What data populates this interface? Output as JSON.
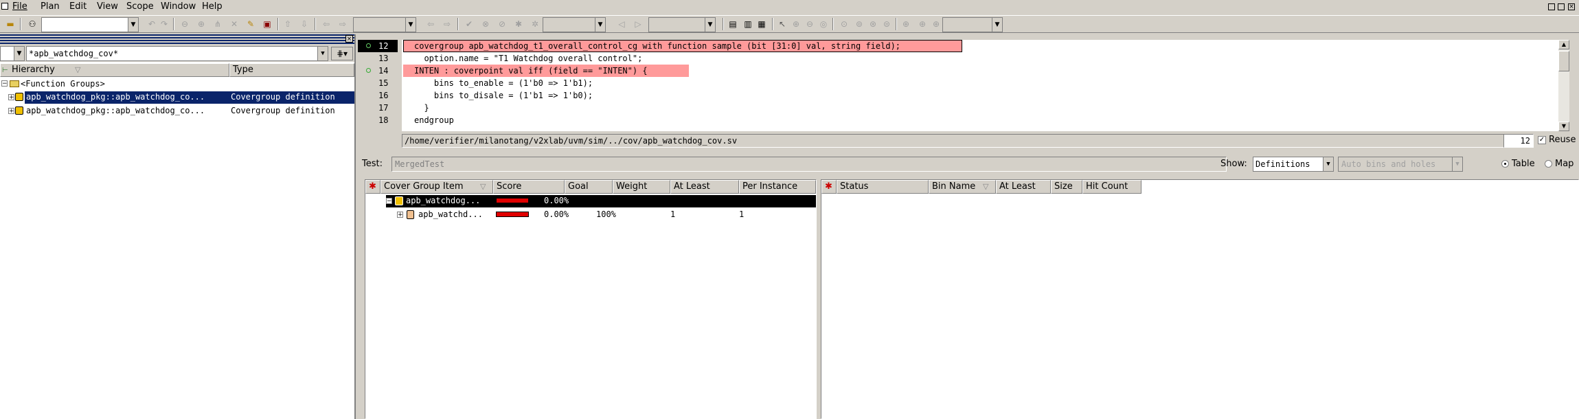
{
  "menu": {
    "items": [
      "File",
      "Plan",
      "Edit",
      "View",
      "Scope",
      "Window",
      "Help"
    ]
  },
  "left_panel": {
    "filter_value": "*apb_watchdog_cov*",
    "columns": [
      "Hierarchy",
      "Type"
    ],
    "rows": [
      {
        "name": "<Function Groups>",
        "type": ""
      },
      {
        "name": "apb_watchdog_pkg::apb_watchdog_co...",
        "type": "Covergroup definition"
      },
      {
        "name": "apb_watchdog_pkg::apb_watchdog_co...",
        "type": "Covergroup definition"
      }
    ]
  },
  "source": {
    "line_numbers": [
      "12",
      "13",
      "14",
      "15",
      "16",
      "17",
      "18"
    ],
    "lines": [
      [
        "covergroup apb_watchdog_t1_overall_control_cg with function sample (bit [31:0] val, string field);"
      ],
      [
        "  option.name = \"T1 Watchdog overall control\";"
      ],
      [
        "INTEN : coverpoint val iff (field == \"INTEN\") {"
      ],
      [
        "    bins to_enable = (1'b0 => 1'b1);"
      ],
      [
        "    bins to_disale = (1'b1 => 1'b0);"
      ],
      [
        "  }"
      ],
      [
        "endgroup"
      ]
    ],
    "path": "/home/verifier/milanotang/v2xlab/uvm/sim/../cov/apb_watchdog_cov.sv",
    "line_field": "12",
    "reuse_label": "Reuse"
  },
  "test_bar": {
    "test_label": "Test:",
    "test_value": "MergedTest",
    "show_label": "Show:",
    "show_value": "Definitions",
    "auto_bins_value": "Auto bins and holes",
    "table_label": "Table",
    "map_label": "Map"
  },
  "cover_table": {
    "columns": [
      "Cover Group Item",
      "Score",
      "Goal",
      "Weight",
      "At Least",
      "Per Instance"
    ],
    "rows": [
      {
        "name": "apb_watchdog...",
        "score": "0.00%",
        "goal": "",
        "weight": "",
        "at_least": "",
        "per_instance": ""
      },
      {
        "name": "apb_watchd...",
        "score": "0.00%",
        "goal": "100%",
        "weight": "1",
        "at_least": "1",
        "per_instance": ""
      }
    ]
  },
  "bin_table": {
    "columns": [
      "Status",
      "Bin Name",
      "At Least",
      "Size",
      "Hit Count"
    ]
  },
  "colors": {
    "selection": "#0a246a",
    "highlight": "#ff9a9a",
    "keyword": "#7b1fa2",
    "identifier": "#1a33c9",
    "score_bar": "#e00000"
  }
}
